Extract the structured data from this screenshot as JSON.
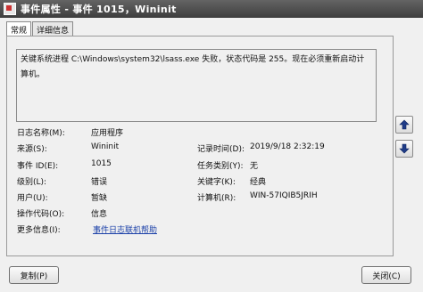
{
  "window": {
    "title": "事件属性 - 事件 1015，Wininit"
  },
  "tabs": [
    {
      "label": "常规"
    },
    {
      "label": "详细信息"
    }
  ],
  "description": "关键系统进程 C:\\Windows\\system32\\lsass.exe 失败，状态代码是 255。现在必须重新启动计算机。",
  "fields": {
    "log_name": {
      "label": "日志名称(M):",
      "value": "应用程序"
    },
    "source": {
      "label": "来源(S):",
      "value": "Wininit"
    },
    "logged": {
      "label": "记录时间(D):",
      "value": "2019/9/18 2:32:19"
    },
    "event_id": {
      "label": "事件 ID(E):",
      "value": "1015"
    },
    "task_category": {
      "label": "任务类别(Y):",
      "value": "无"
    },
    "level": {
      "label": "级别(L):",
      "value": "错误"
    },
    "keywords": {
      "label": "关键字(K):",
      "value": "经典"
    },
    "user": {
      "label": "用户(U):",
      "value": "暂缺"
    },
    "computer": {
      "label": "计算机(R):",
      "value": "WIN-57IQIB5JRIH"
    },
    "opcode": {
      "label": "操作代码(O):",
      "value": "信息"
    },
    "more_info": {
      "label": "更多信息(I):",
      "value": "事件日志联机帮助"
    }
  },
  "buttons": {
    "copy": "复制(P)",
    "close": "关闭(C)"
  },
  "icons": {
    "nav_up": "arrow-up-icon",
    "nav_down": "arrow-down-icon"
  }
}
